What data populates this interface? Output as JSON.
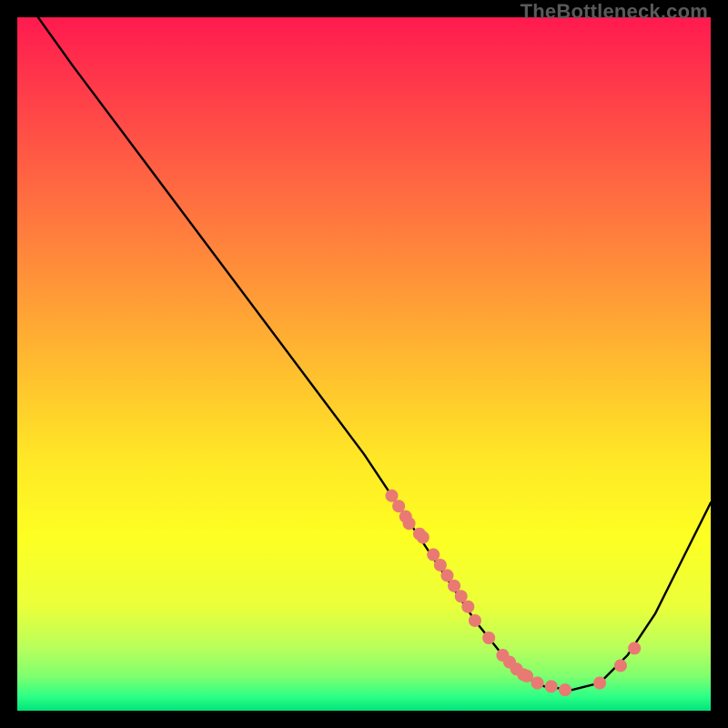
{
  "watermark": {
    "text": "TheBottleneck.com"
  },
  "chart_data": {
    "type": "line",
    "title": "",
    "xlabel": "",
    "ylabel": "",
    "xlim": [
      0,
      100
    ],
    "ylim": [
      0,
      100
    ],
    "curve": {
      "x": [
        3,
        8,
        14,
        20,
        26,
        32,
        38,
        44,
        50,
        54,
        56,
        58,
        60,
        62,
        64,
        66,
        68,
        70,
        72,
        74,
        76,
        80,
        84,
        88,
        92,
        96,
        100
      ],
      "y": [
        100,
        93,
        85,
        77,
        69,
        61,
        53,
        45,
        37,
        31,
        28,
        25,
        22,
        19,
        16,
        13,
        10.5,
        8,
        6,
        4.5,
        3.5,
        3,
        4,
        8,
        14,
        22,
        30
      ]
    },
    "points": {
      "x": [
        54,
        55,
        56,
        56.5,
        58,
        58.5,
        60,
        61,
        62,
        63,
        64,
        65,
        66,
        68,
        70,
        71,
        72,
        73,
        73.5,
        75,
        77,
        79,
        84,
        87,
        89
      ],
      "y": [
        31,
        29.5,
        28,
        27,
        25.5,
        25,
        22.5,
        21,
        19.5,
        18,
        16.5,
        15,
        13,
        10.5,
        8,
        7,
        6,
        5.2,
        5,
        4,
        3.5,
        3,
        4,
        6.5,
        9
      ]
    },
    "colors": {
      "curve": "#000000",
      "points": "#e87a73"
    }
  }
}
